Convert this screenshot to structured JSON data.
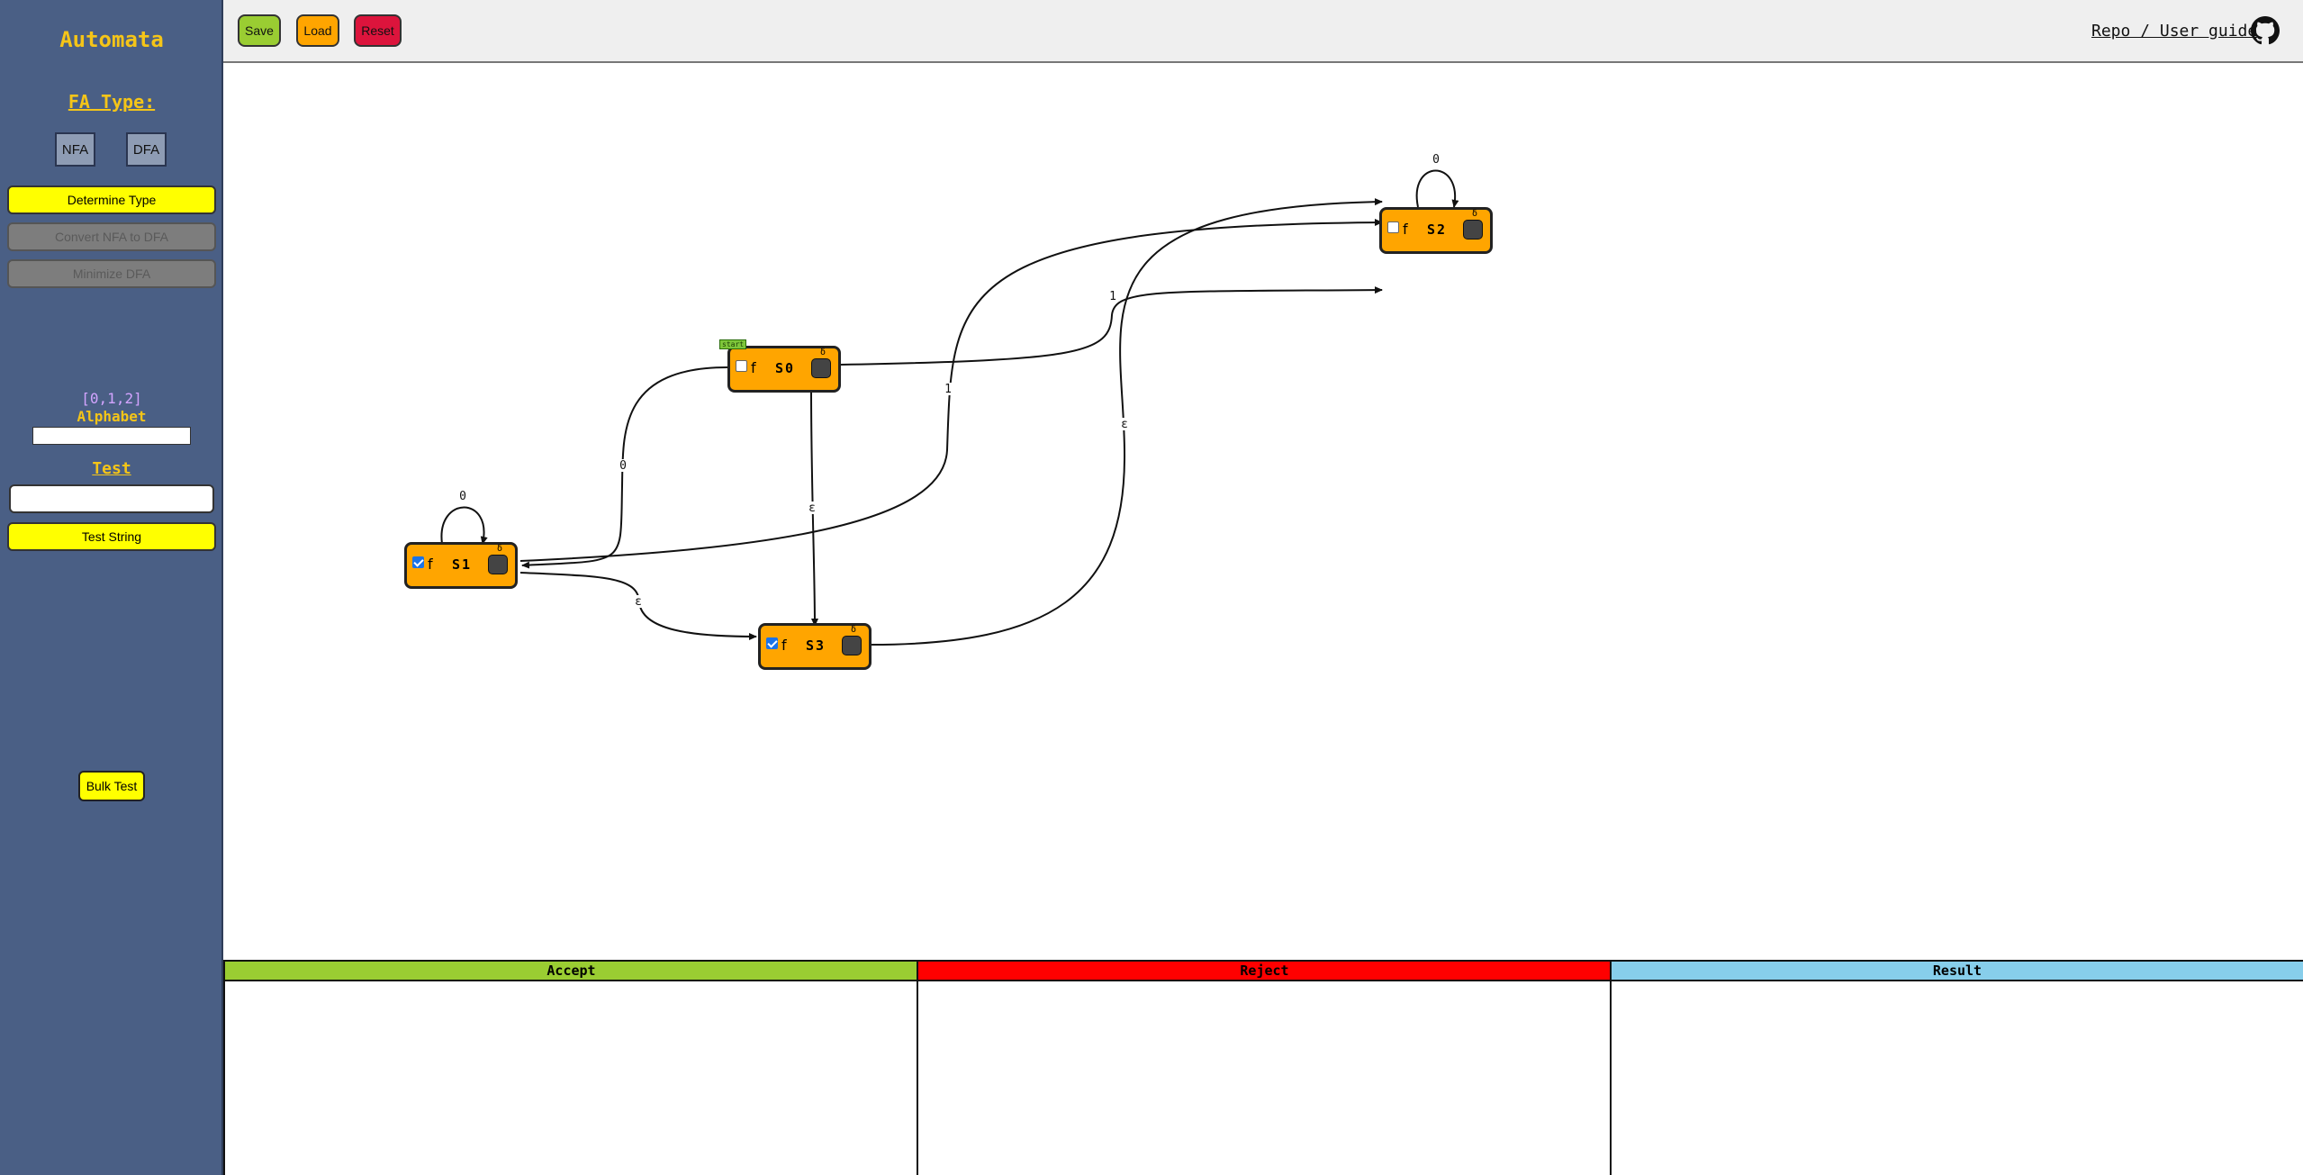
{
  "sidebar": {
    "title": "Automata",
    "fa_type_label": "FA Type:",
    "nfa_label": "NFA",
    "dfa_label": "DFA",
    "determine_type_label": "Determine Type",
    "convert_label": "Convert NFA to DFA",
    "minimize_label": "Minimize DFA",
    "alphabet_value": "[0,1,2]",
    "alphabet_label": "Alphabet",
    "alphabet_input": "",
    "test_label": "Test",
    "test_input": "",
    "test_button_label": "Test String",
    "bulk_test_label": "Bulk Test"
  },
  "toolbar": {
    "save_label": "Save",
    "load_label": "Load",
    "reset_label": "Reset",
    "repo_link": "Repo / User guide",
    "github_icon": "github-icon"
  },
  "states": [
    {
      "name": "S0",
      "final": false,
      "start": true,
      "f_label": "f",
      "start_label": "start",
      "delta": "δ"
    },
    {
      "name": "S1",
      "final": true,
      "start": false,
      "f_label": "f",
      "delta": "δ"
    },
    {
      "name": "S2",
      "final": false,
      "start": false,
      "f_label": "f",
      "delta": "δ"
    },
    {
      "name": "S3",
      "final": true,
      "start": false,
      "f_label": "f",
      "delta": "δ"
    }
  ],
  "transitions": [
    {
      "from": "S0",
      "to": "S2",
      "label": "1"
    },
    {
      "from": "S0",
      "to": "S1",
      "label": "0"
    },
    {
      "from": "S0",
      "to": "S3",
      "label": "ε"
    },
    {
      "from": "S1",
      "to": "S1",
      "label": "0"
    },
    {
      "from": "S1",
      "to": "S2",
      "label": "1"
    },
    {
      "from": "S1",
      "to": "S3",
      "label": "ε"
    },
    {
      "from": "S2",
      "to": "S2",
      "label": "0"
    },
    {
      "from": "S3",
      "to": "S2",
      "label": "ε"
    }
  ],
  "results": {
    "accept_label": "Accept",
    "reject_label": "Reject",
    "result_label": "Result"
  },
  "colors": {
    "sidebar_bg": "#4a5f85",
    "accent_yellow": "#f5c518",
    "alphabet_value": "#d3a4ff",
    "state_fill": "#ffa500",
    "save_btn": "#9acd32",
    "load_btn": "#ffa500",
    "reset_btn": "#dc143c",
    "accept": "#9acd32",
    "reject": "#ff0000",
    "result": "#87ceeb"
  }
}
